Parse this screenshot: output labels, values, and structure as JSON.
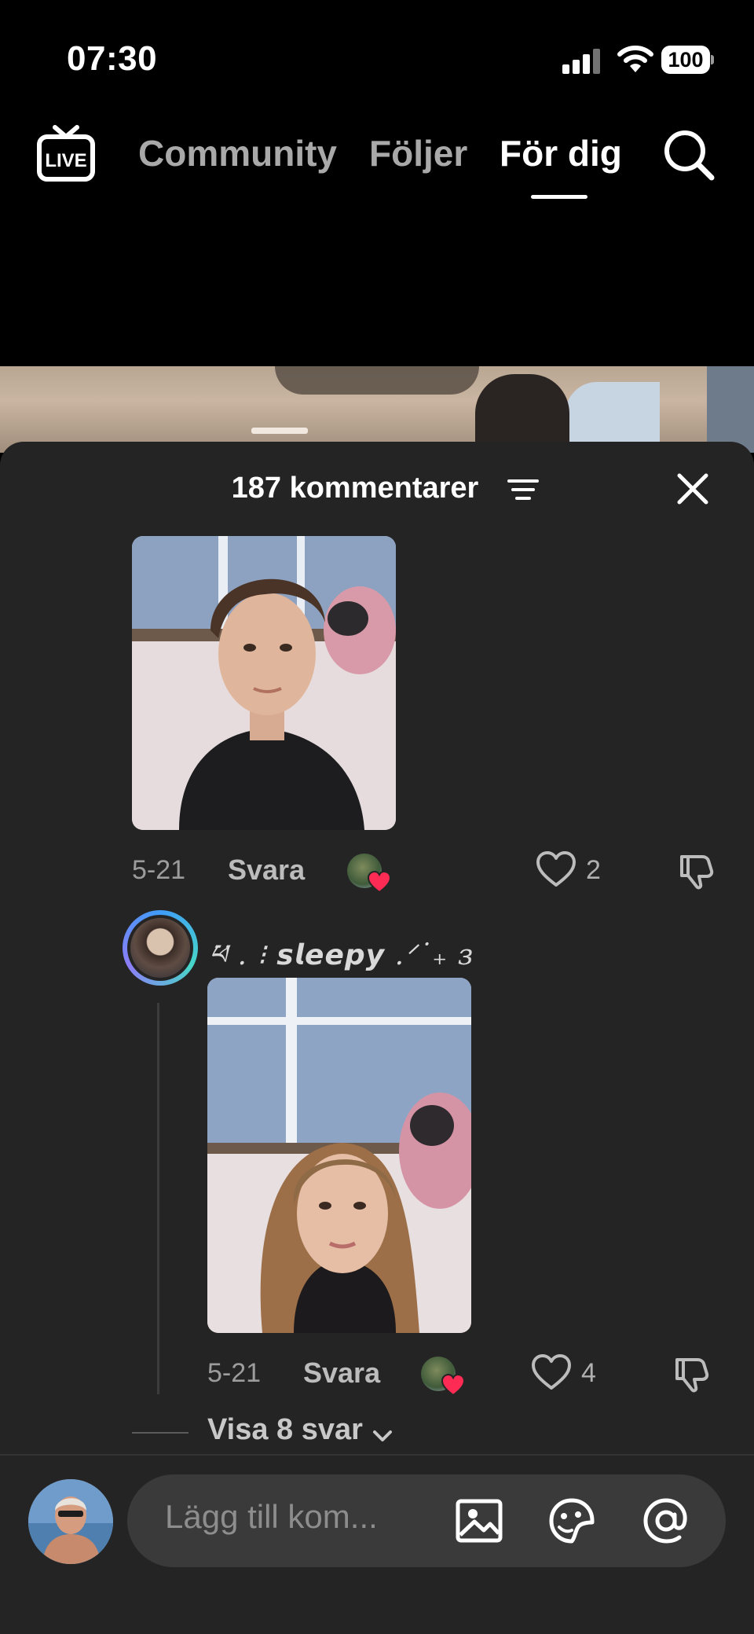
{
  "status": {
    "time": "07:30",
    "battery": "100"
  },
  "nav": {
    "live": "LIVE",
    "tabs": [
      "Community",
      "Följer",
      "För dig"
    ],
    "active_tab": 2
  },
  "comments": {
    "title": "187 kommentarer",
    "items": [
      {
        "date": "5-21",
        "reply_label": "Svara",
        "likes": "2"
      },
      {
        "username": "ཕ . ⁝ 𝙨𝙡𝙚𝙚𝙥𝙮 .ᐟ˙₊ з",
        "date": "5-21",
        "reply_label": "Svara",
        "likes": "4"
      }
    ],
    "view_more": "Visa 8 svar"
  },
  "input": {
    "placeholder": "Lägg till kom..."
  },
  "colors": {
    "background": "#000000",
    "sheet": "#242424",
    "heart": "#fe2c55",
    "avatar_ring": "#47d7c8"
  }
}
